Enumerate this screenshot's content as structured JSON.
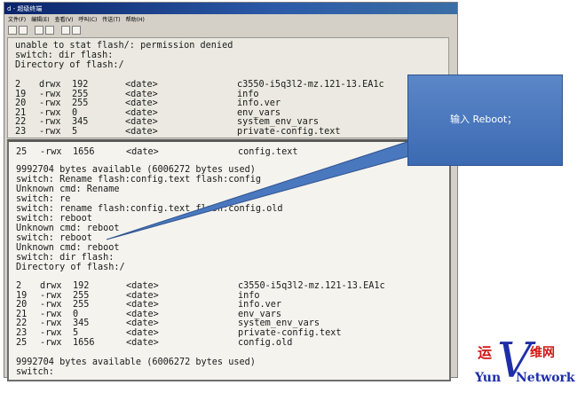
{
  "window": {
    "title": "d - 超级终端",
    "menu": [
      "文件(F)",
      "编辑(E)",
      "查看(V)",
      "呼叫(C)",
      "传送(T)",
      "帮助(H)"
    ],
    "toolbar_icons": [
      "new-icon",
      "open-icon",
      "connect-icon",
      "disconnect-icon",
      "send-icon",
      "properties-icon"
    ]
  },
  "terminal_top": {
    "lines": [
      "unable to stat flash/: permission denied",
      "switch: dir flash:",
      "Directory of flash:/"
    ],
    "dir": [
      {
        "num": "2",
        "perm": "drwx",
        "size": "192",
        "date": "<date>",
        "name": "c3550-i5q3l2-mz.121-13.EA1c"
      },
      {
        "num": "19",
        "perm": "-rwx",
        "size": "255",
        "date": "<date>",
        "name": "info"
      },
      {
        "num": "20",
        "perm": "-rwx",
        "size": "255",
        "date": "<date>",
        "name": "info.ver"
      },
      {
        "num": "21",
        "perm": "-rwx",
        "size": "0",
        "date": "<date>",
        "name": "env_vars"
      },
      {
        "num": "22",
        "perm": "-rwx",
        "size": "345",
        "date": "<date>",
        "name": "system_env_vars"
      },
      {
        "num": "23",
        "perm": "-rwx",
        "size": "5",
        "date": "<date>",
        "name": "private-config.text"
      }
    ]
  },
  "terminal_main": {
    "first_row": {
      "num": "25",
      "perm": "-rwx",
      "size": "1656",
      "date": "<date>",
      "name": "config.text"
    },
    "lines": [
      "9992704 bytes available (6006272 bytes used)",
      "switch: Rename flash:config.text flash:config",
      "Unknown cmd: Rename",
      "switch: re",
      "switch: rename flash:config.text flash:config.old",
      "switch: reboot",
      "Unknown cmd: reboot",
      "switch: reboot",
      "Unknown cmd: reboot",
      "switch: dir flash:",
      "Directory of flash:/"
    ],
    "dir": [
      {
        "num": "2",
        "perm": "drwx",
        "size": "192",
        "date": "<date>",
        "name": "c3550-i5q3l2-mz.121-13.EA1c"
      },
      {
        "num": "19",
        "perm": "-rwx",
        "size": "255",
        "date": "<date>",
        "name": "info"
      },
      {
        "num": "20",
        "perm": "-rwx",
        "size": "255",
        "date": "<date>",
        "name": "info.ver"
      },
      {
        "num": "21",
        "perm": "-rwx",
        "size": "0",
        "date": "<date>",
        "name": "env_vars"
      },
      {
        "num": "22",
        "perm": "-rwx",
        "size": "345",
        "date": "<date>",
        "name": "system_env_vars"
      },
      {
        "num": "23",
        "perm": "-rwx",
        "size": "5",
        "date": "<date>",
        "name": "private-config.text"
      },
      {
        "num": "25",
        "perm": "-rwx",
        "size": "1656",
        "date": "<date>",
        "name": "config.old"
      }
    ],
    "footer": [
      "9992704 bytes available (6006272 bytes used)",
      "switch:"
    ]
  },
  "callout": {
    "text": "输入 Reboot；",
    "color": "#4a78be"
  },
  "logo": {
    "cn1": "运",
    "cn2": "维网",
    "v": "V",
    "yun": "Yun",
    "net": "Network",
    "colors": {
      "red": "#d01515",
      "blue": "#1f2ea8"
    }
  }
}
